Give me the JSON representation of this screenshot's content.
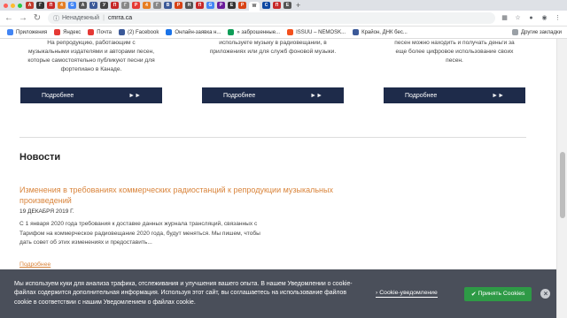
{
  "browser": {
    "tab_icons": [
      "A",
      "Г",
      "П",
      "4",
      "G",
      "A",
      "V",
      "У",
      "П",
      "Г",
      "Р",
      "4",
      "Г",
      "В",
      "Р",
      "Н",
      "П",
      "G",
      "P",
      "Е",
      "Р",
      "W",
      "C",
      "П",
      "Е"
    ],
    "url_prefix": "Ненадежный",
    "url_host": "cmrra.ca",
    "bookmarks": [
      {
        "label": "Приложения",
        "color": "#4285f4"
      },
      {
        "label": "Яндекс",
        "color": "#e53935"
      },
      {
        "label": "Почта",
        "color": "#e53935"
      },
      {
        "label": "(2) Facebook",
        "color": "#3b5998"
      },
      {
        "label": "Онлайн-заявка н...",
        "color": "#1a73e8"
      },
      {
        "label": "» заброшенные...",
        "color": "#0f9d58"
      },
      {
        "label": "ISSUU – NEMOSK...",
        "color": "#f4511e"
      },
      {
        "label": "Крайон, ДНК бес...",
        "color": "#3b5998"
      }
    ],
    "other_bookmarks": "Другие закладки"
  },
  "cards": [
    {
      "text": "На репродукцию, работающим с музыкальными издателями и авторами песен, которые самостоятельно публикуют песни для фортепиано в Канаде.",
      "button": "Подробнее"
    },
    {
      "text": "используете музыку в радиовещании, в приложениях или для служб фоновой музыки.",
      "button": "Подробнее"
    },
    {
      "text": "песен можно находить и получать деньги за еще более цифровое использование своих песен.",
      "button": "Подробнее"
    }
  ],
  "news": {
    "heading": "Новости",
    "title": "Изменения в требованиях коммерческих радиостанций к репродукции музыкальных произведений",
    "date": "19 ДЕКАБРЯ 2019 Г.",
    "body": "С 1 января 2020 года требования к доставке данных журнала трансляций, связанных с Тарифом на коммерческое радиовещание 2020 года, будут меняться. Мы пишем, чтобы дать совет об этих изменениях и предоставить...",
    "more": "Подробнее"
  },
  "cookie": {
    "text": "Мы используем куки для анализа трафика, отслеживания и улучшения вашего опыта. В нашем Уведомлении о cookie-файлах содержится дополнительная информация. Используя этот сайт, вы соглашаетесь на использование файлов cookie в соответствии с нашим Уведомлением о файлах cookie.",
    "notice_link": "Cookie-уведомление",
    "accept": "Принять Cookies"
  }
}
